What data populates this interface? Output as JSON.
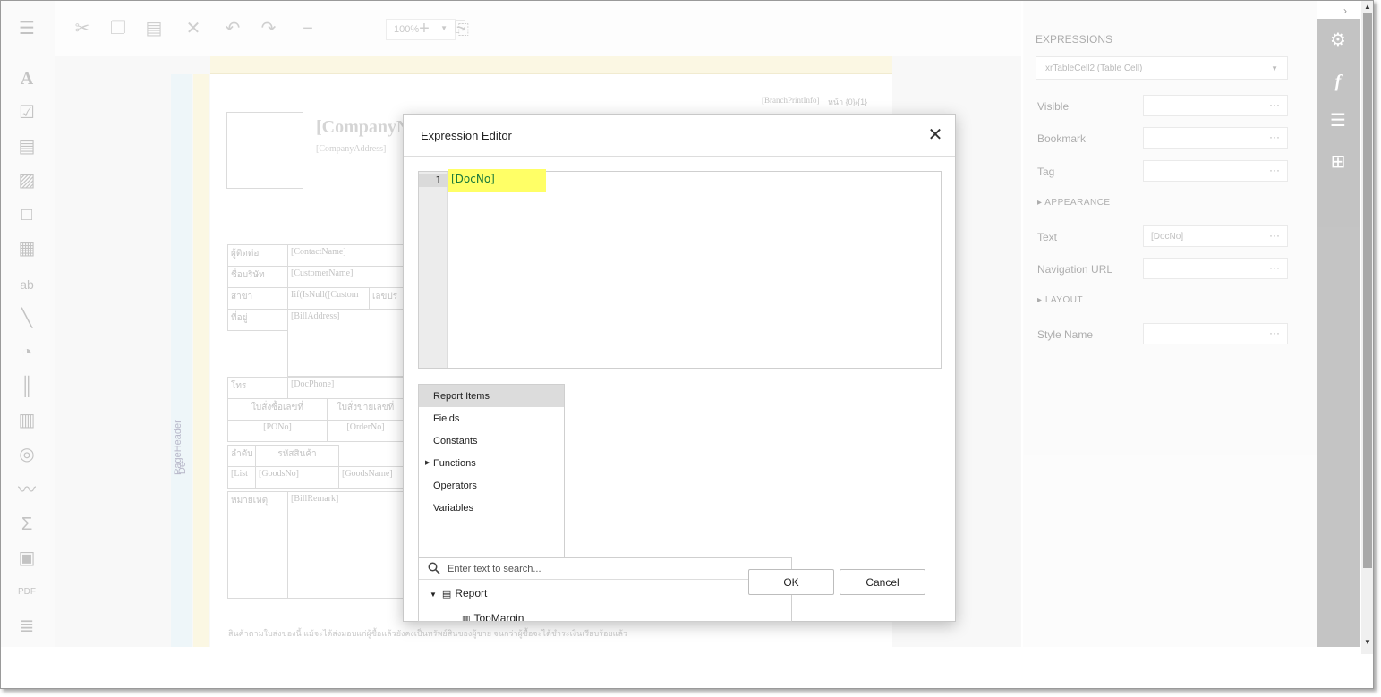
{
  "toolbar": {
    "zoom_value": "100%"
  },
  "report": {
    "company_name": "[CompanyN",
    "company_address": "[CompanyAddress]",
    "branch_print_info": "[BranchPrintInfo]",
    "page_info": "หน้า {0}/{1}",
    "band_label": "PageHeader",
    "band_label_short": "De",
    "rows": [
      {
        "label": "ผู้ติดต่อ",
        "value": "[ContactName]"
      },
      {
        "label": "ชื่อบริษัท",
        "value": "[CustomerName]"
      },
      {
        "label": "สาขา",
        "value": "Iif(IsNull([Custom"
      },
      {
        "label": "ที่อยู่",
        "value": "[BillAddress]"
      },
      {
        "label": "โทร",
        "value": "[DocPhone]"
      }
    ],
    "branch_extra": "เลขปร",
    "po_header": "ใบสั่งซื้อเลขที่",
    "order_header": "ใบสั่งขายเลขที่",
    "po_value": "[PONo]",
    "order_value": "[OrderNo]",
    "seq_header": "ลำดับ",
    "goods_header": "รหัสสินค้า",
    "seq_value": "[List",
    "goods_value": "[GoodsNo]",
    "goods_name": "[GoodsName]",
    "remark_label": "หมายเหตุ",
    "remark_value": "[BillRemark]",
    "footer_note": "สินค้าตามใบส่งของนี้ แม้จะได้ส่งมอบแก่ผู้ซื้อแล้วยังคงเป็นทรัพย์สินของผู้ขาย จนกว่าผู้ซื้อจะได้ชำระเงินเรียบร้อยแล้ว"
  },
  "properties": {
    "heading": "EXPRESSIONS",
    "selected_component": "xrTableCell2 (Table Cell)",
    "rows": [
      {
        "label": "Visible",
        "value": ""
      },
      {
        "label": "Bookmark",
        "value": ""
      },
      {
        "label": "Tag",
        "value": ""
      }
    ],
    "appearance_section": "APPEARANCE",
    "text_label": "Text",
    "text_value": "[DocNo]",
    "nav_label": "Navigation URL",
    "layout_section": "LAYOUT",
    "style_label": "Style Name",
    "dots": "···"
  },
  "dialog": {
    "title": "Expression Editor",
    "close_symbol": "✕",
    "editor": {
      "line_number": "1",
      "expression": "[DocNo]"
    },
    "categories": [
      {
        "label": "Report Items",
        "selected": true,
        "expandable": false
      },
      {
        "label": "Fields",
        "selected": false,
        "expandable": false
      },
      {
        "label": "Constants",
        "selected": false,
        "expandable": false
      },
      {
        "label": "Functions",
        "selected": false,
        "expandable": true
      },
      {
        "label": "Operators",
        "selected": false,
        "expandable": false
      },
      {
        "label": "Variables",
        "selected": false,
        "expandable": false
      }
    ],
    "search_placeholder": "Enter text to search...",
    "tree": {
      "root": "Report",
      "child": "TopMargin"
    },
    "ok_label": "OK",
    "cancel_label": "Cancel"
  },
  "colors": {
    "highlight": "#ffff66",
    "code_text": "#1a7a3a",
    "selected_item": "#dcdcdc"
  }
}
